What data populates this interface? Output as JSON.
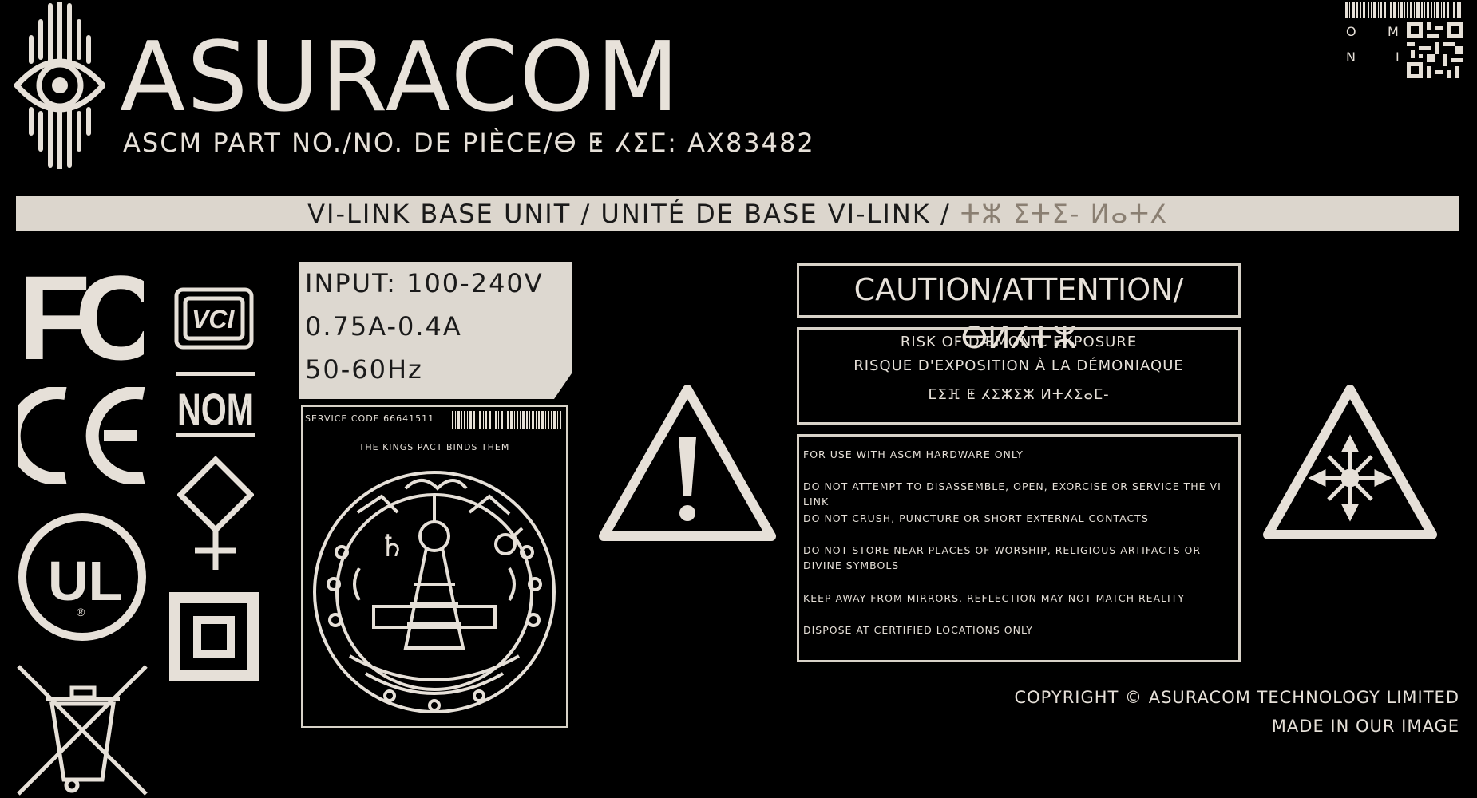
{
  "brand": {
    "name": "ASURACOM",
    "part_no_label": "ASCM PART NO./NO. DE PIÈCE/ⴱ ⵟ ⵃⵉⵎ:",
    "part_no": "AX83482"
  },
  "banner": {
    "text": "VI-LINK BASE UNIT / UNITÉ DE BASE VI-LINK /",
    "glyph_text": "ⵜⵣ ⵉⵜⵉ- ⵍⴰⵜⵃ"
  },
  "corner": {
    "letters": [
      "O",
      "M",
      "N",
      "I"
    ]
  },
  "ratings": {
    "input": "INPUT: 100-240V",
    "current": "0.75A-0.4A",
    "frequency": "50-60Hz"
  },
  "seal": {
    "service_code": "SERVICE CODE 66641511",
    "motto": "THE KINGS PACT BINDS THEM"
  },
  "caution": {
    "title": "CAUTION/ATTENTION/",
    "title_glyphs": "ⴱⵍⵃⵜⵣ",
    "risk_en": "RISK OF DÆMONIC EXPOSURE",
    "risk_fr": "RISQUE D'EXPOSITION À LA DÉMONIAQUE",
    "risk_glyphs": "ⵎⵉⴼ ⵟ ⵃⵉⵣⵉⵣ ⵍⵜⵃⵉⴰⵎ-",
    "warnings": [
      "FOR USE WITH ASCM HARDWARE ONLY",
      "DO NOT ATTEMPT TO DISASSEMBLE, OPEN, EXORCISE OR SERVICE THE VI LINK",
      "DO NOT CRUSH, PUNCTURE OR SHORT EXTERNAL CONTACTS",
      "DO NOT STORE NEAR PLACES OF WORSHIP, RELIGIOUS ARTIFACTS OR DIVINE SYMBOLS",
      "KEEP AWAY FROM MIRRORS. REFLECTION MAY NOT MATCH REALITY",
      "DISPOSE AT CERTIFIED LOCATIONS ONLY"
    ]
  },
  "footer": {
    "copyright": "COPYRIGHT © ASURACOM TECHNOLOGY LIMITED",
    "made_in": "MADE IN OUR IMAGE"
  },
  "marks": {
    "fc": "FC",
    "ce": "CE",
    "ul": "UL",
    "vci": "VCI",
    "nom": "NOM"
  },
  "icons": [
    "eye-logo-icon",
    "fc-mark-icon",
    "ce-mark-icon",
    "ul-mark-icon",
    "vci-mark-icon",
    "nom-mark-icon",
    "diamond-cross-icon",
    "double-square-icon",
    "weee-bin-icon",
    "sigil-seal-icon",
    "warning-exclamation-icon",
    "warning-chaos-icon",
    "barcode-icon",
    "qr-code-icon"
  ],
  "colors": {
    "background": "#000000",
    "label": "#e6e0d8",
    "band": "#dcd6cd",
    "glyph": "#8a7f72"
  }
}
